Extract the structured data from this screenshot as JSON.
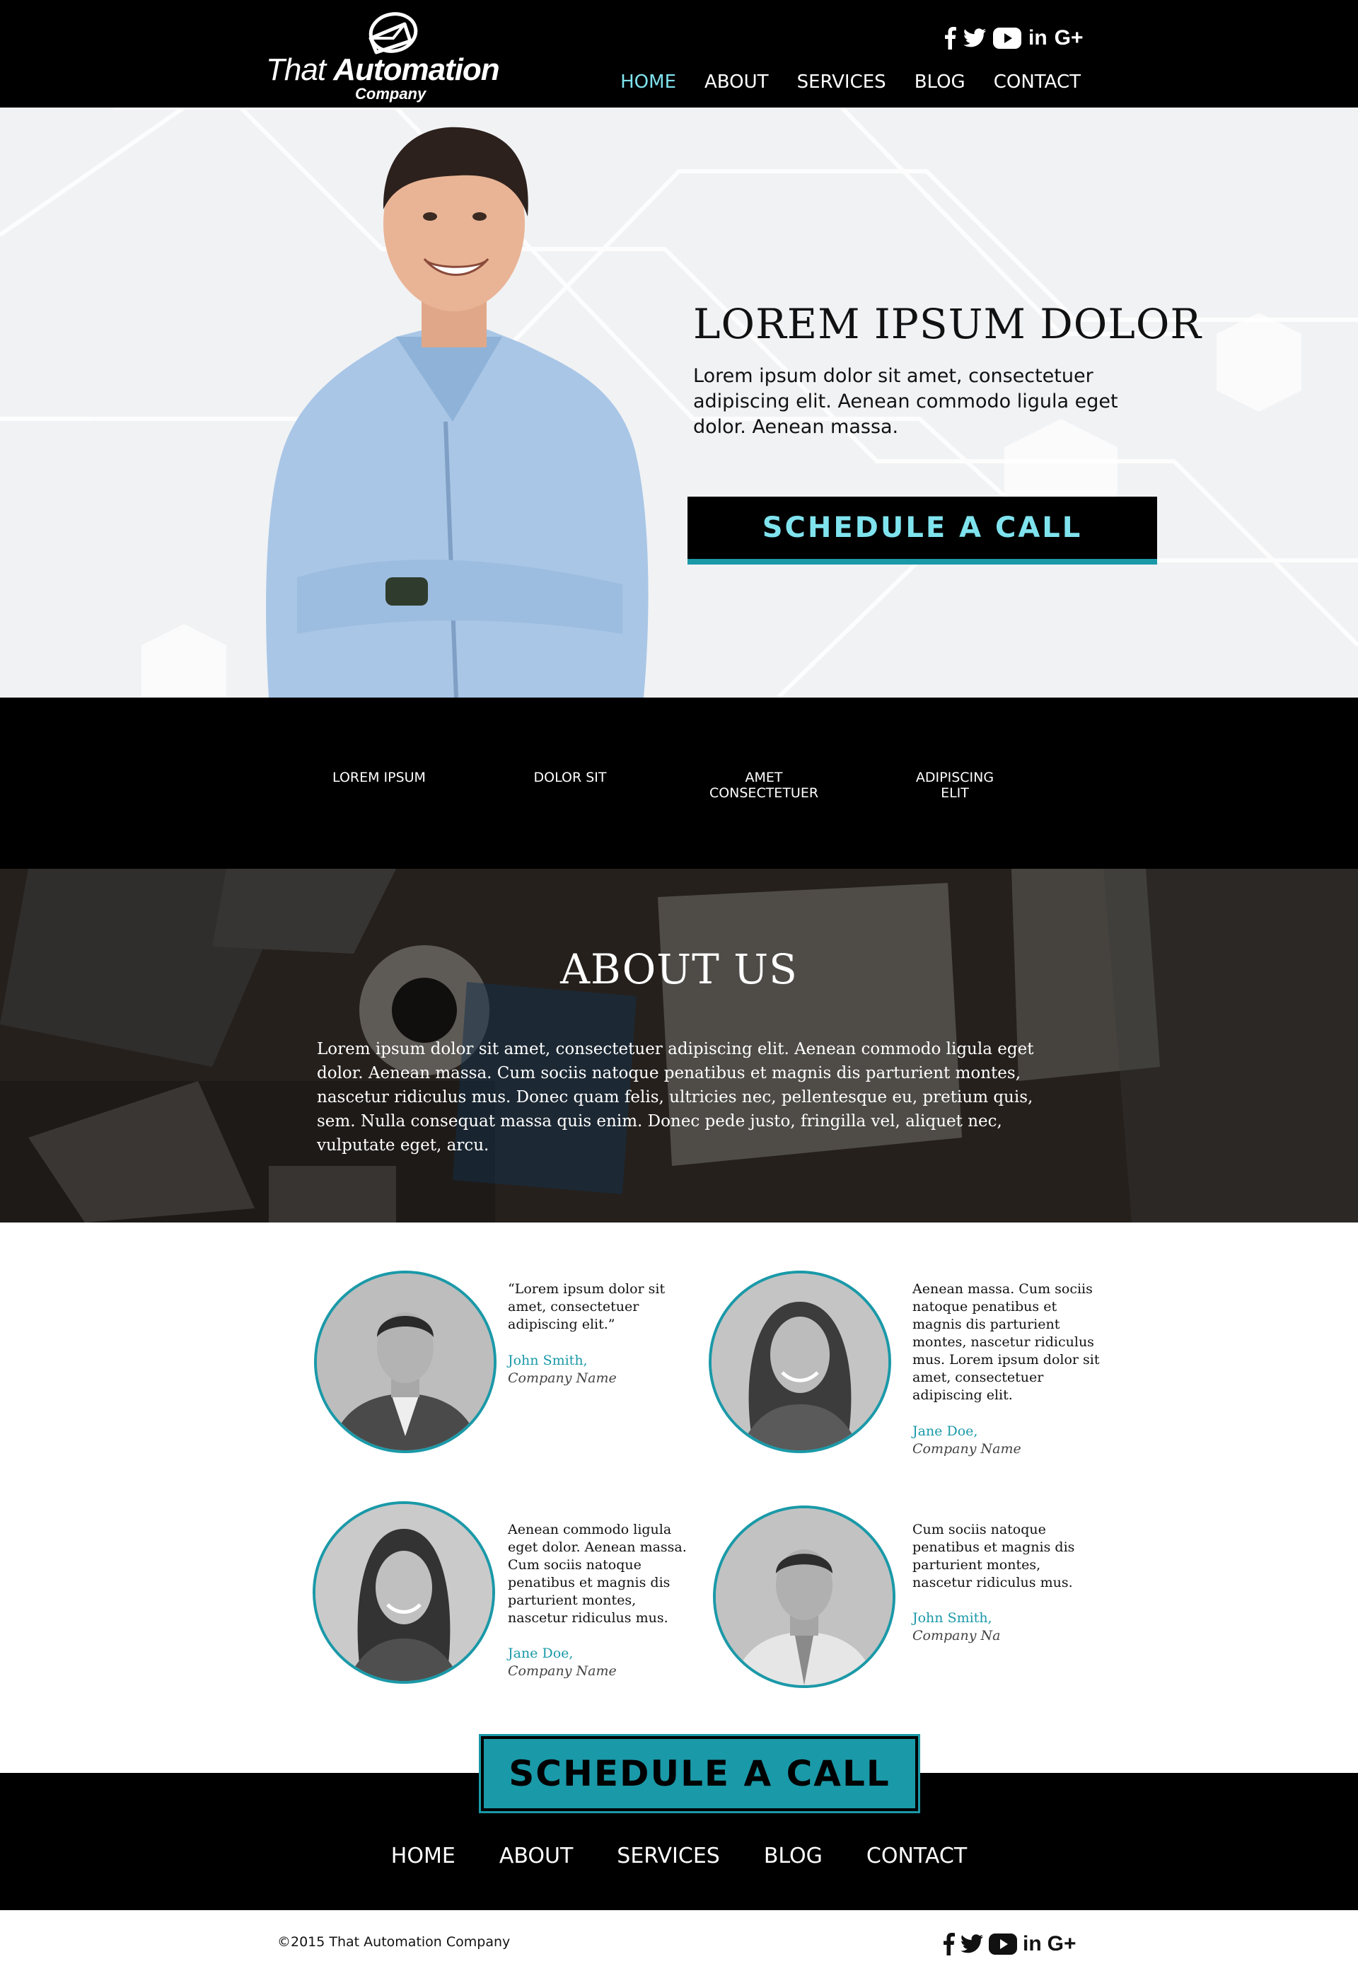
{
  "brand": {
    "logo_line1_light": "That",
    "logo_line1_bold": "Automation",
    "logo_line2": "Company",
    "accent": "#1a99a8",
    "accent_light": "#7fe3ee"
  },
  "social": {
    "facebook": "facebook-icon",
    "twitter": "twitter-icon",
    "youtube": "youtube-icon",
    "linkedin": "in",
    "googleplus": "G+"
  },
  "nav": {
    "home": "HOME",
    "about": "ABOUT",
    "services": "SERVICES",
    "blog": "BLOG",
    "contact": "CONTACT"
  },
  "hero": {
    "title": "LOREM IPSUM DOLOR",
    "text": "Lorem ipsum dolor sit amet, consectetuer adipiscing elit. Aenean commodo ligula eget dolor. Aenean massa.",
    "cta": "SCHEDULE A CALL"
  },
  "features": [
    {
      "line1": "LOREM IPSUM",
      "line2": ""
    },
    {
      "line1": "DOLOR SIT",
      "line2": ""
    },
    {
      "line1": "AMET",
      "line2": "CONSECTETUER"
    },
    {
      "line1": "ADIPISCING",
      "line2": "ELIT"
    }
  ],
  "about": {
    "title": "ABOUT US",
    "text": "Lorem ipsum dolor sit amet, consectetuer adipiscing elit. Aenean commodo ligula eget dolor. Aenean massa. Cum sociis natoque penatibus et magnis dis parturient montes, nascetur ridiculus mus. Donec quam felis, ultricies nec, pellentesque eu, pretium quis, sem. Nulla consequat massa quis enim. Donec pede justo, fringilla vel, aliquet nec, vulputate eget, arcu."
  },
  "testimonials": [
    {
      "quote": "“Lorem ipsum dolor sit amet, consectetuer adipiscing elit.”",
      "name": "John Smith,",
      "company": "Company Name"
    },
    {
      "quote": " Aenean massa. Cum sociis natoque penatibus et magnis dis parturient montes, nascetur ridiculus mus. Lorem ipsum dolor sit amet, consectetuer adipiscing elit.",
      "name": "Jane Doe,",
      "company": "Company Name"
    },
    {
      "quote": "Aenean commodo ligula eget dolor. Aenean massa. Cum sociis natoque penatibus et magnis dis parturient montes, nascetur ridiculus mus.",
      "name": "Jane Doe,",
      "company": "Company Name"
    },
    {
      "quote": "Cum sociis natoque penatibus et magnis dis parturient montes, nascetur ridiculus mus.",
      "name": "John Smith,",
      "company": "Company Na"
    }
  ],
  "footer": {
    "cta": "SCHEDULE A CALL",
    "copyright": "©2015 That Automation Company"
  }
}
